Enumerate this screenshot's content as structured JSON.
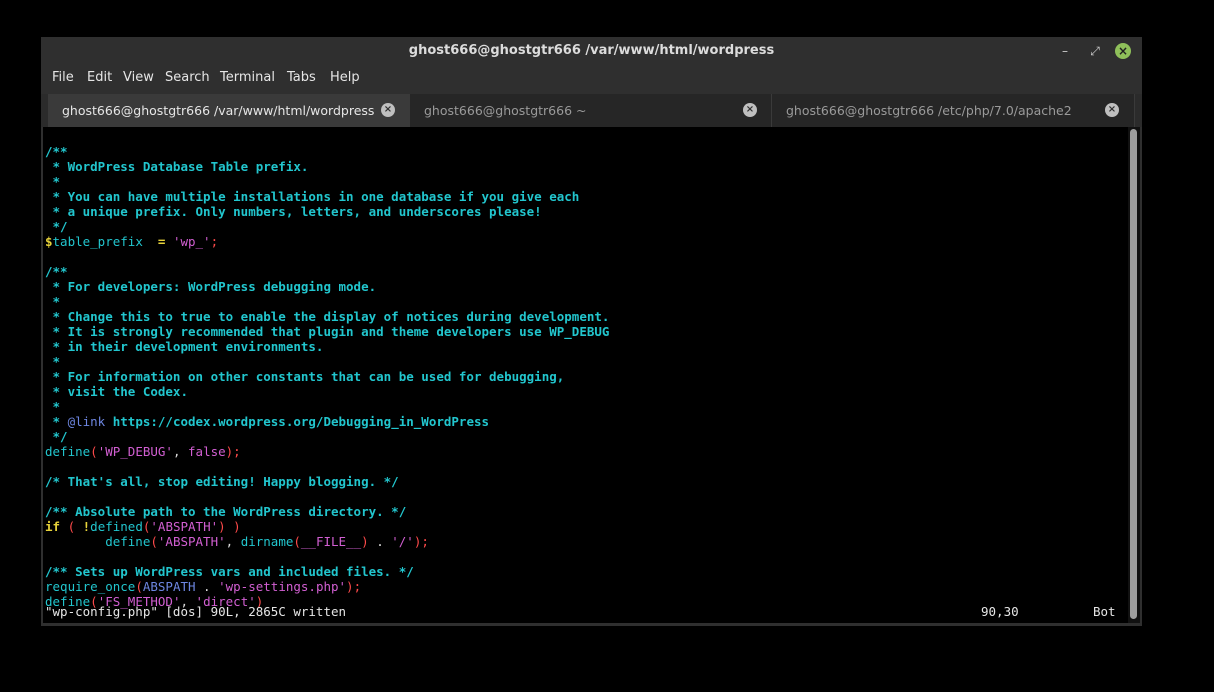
{
  "window": {
    "title": "ghost666@ghostgtr666 /var/www/html/wordpress"
  },
  "menu": [
    "File",
    "Edit",
    "View",
    "Search",
    "Terminal",
    "Tabs",
    "Help"
  ],
  "tabs": [
    {
      "label": "ghost666@ghostgtr666 /var/www/html/wordpress",
      "active": true
    },
    {
      "label": "ghost666@ghostgtr666 ~",
      "active": false
    },
    {
      "label": "ghost666@ghostgtr666 /etc/php/7.0/apache2",
      "active": false
    }
  ],
  "terminal": {
    "lines": [
      [
        {
          "t": "/**",
          "c": "com"
        }
      ],
      [
        {
          "t": " * WordPress Database Table prefix.",
          "c": "com"
        }
      ],
      [
        {
          "t": " *",
          "c": "com"
        }
      ],
      [
        {
          "t": " * You can have multiple installations in one database if you give each",
          "c": "com"
        }
      ],
      [
        {
          "t": " * a unique prefix. Only numbers, letters, and underscores please!",
          "c": "com"
        }
      ],
      [
        {
          "t": " */",
          "c": "com"
        }
      ],
      [
        {
          "t": "$",
          "c": "y"
        },
        {
          "t": "table_prefix  ",
          "c": "var"
        },
        {
          "t": "= ",
          "c": "y"
        },
        {
          "t": "'wp_'",
          "c": "str"
        },
        {
          "t": ";",
          "c": "p"
        }
      ],
      [
        {
          "t": "",
          "c": "w"
        }
      ],
      [
        {
          "t": "/**",
          "c": "com"
        }
      ],
      [
        {
          "t": " * For developers: WordPress debugging mode.",
          "c": "com"
        }
      ],
      [
        {
          "t": " *",
          "c": "com"
        }
      ],
      [
        {
          "t": " * Change this to true to enable the display of notices during development.",
          "c": "com"
        }
      ],
      [
        {
          "t": " * It is strongly recommended that plugin and theme developers use WP_DEBUG",
          "c": "com"
        }
      ],
      [
        {
          "t": " * in their development environments.",
          "c": "com"
        }
      ],
      [
        {
          "t": " *",
          "c": "com"
        }
      ],
      [
        {
          "t": " * For information on other constants that can be used for debugging,",
          "c": "com"
        }
      ],
      [
        {
          "t": " * visit the Codex.",
          "c": "com"
        }
      ],
      [
        {
          "t": " *",
          "c": "com"
        }
      ],
      [
        {
          "t": " * ",
          "c": "com"
        },
        {
          "t": "@link",
          "c": "fn"
        },
        {
          "t": " https://codex.wordpress.org/Debugging_in_WordPress",
          "c": "com"
        }
      ],
      [
        {
          "t": " */",
          "c": "com"
        }
      ],
      [
        {
          "t": "define",
          "c": "var"
        },
        {
          "t": "(",
          "c": "p"
        },
        {
          "t": "'WP_DEBUG'",
          "c": "str"
        },
        {
          "t": ", ",
          "c": "w"
        },
        {
          "t": "false",
          "c": "str"
        },
        {
          "t": ");",
          "c": "p"
        }
      ],
      [
        {
          "t": "",
          "c": "w"
        }
      ],
      [
        {
          "t": "/* That's all, stop editing! Happy blogging. */",
          "c": "com"
        }
      ],
      [
        {
          "t": "",
          "c": "w"
        }
      ],
      [
        {
          "t": "/** Absolute path to the WordPress directory. */",
          "c": "com"
        }
      ],
      [
        {
          "t": "if",
          "c": "y"
        },
        {
          "t": " ( ",
          "c": "p"
        },
        {
          "t": "!",
          "c": "y"
        },
        {
          "t": "defined",
          "c": "var"
        },
        {
          "t": "(",
          "c": "p"
        },
        {
          "t": "'ABSPATH'",
          "c": "str"
        },
        {
          "t": ") )",
          "c": "p"
        }
      ],
      [
        {
          "t": "        define",
          "c": "var"
        },
        {
          "t": "(",
          "c": "p"
        },
        {
          "t": "'ABSPATH'",
          "c": "str"
        },
        {
          "t": ", ",
          "c": "w"
        },
        {
          "t": "dirname",
          "c": "var"
        },
        {
          "t": "(",
          "c": "p"
        },
        {
          "t": "__FILE__",
          "c": "str"
        },
        {
          "t": ") ",
          "c": "p"
        },
        {
          "t": ". ",
          "c": "w"
        },
        {
          "t": "'/'",
          "c": "str"
        },
        {
          "t": ");",
          "c": "p"
        }
      ],
      [
        {
          "t": "",
          "c": "w"
        }
      ],
      [
        {
          "t": "/** Sets up WordPress vars and included files. */",
          "c": "com"
        }
      ],
      [
        {
          "t": "require_once",
          "c": "var"
        },
        {
          "t": "(",
          "c": "p"
        },
        {
          "t": "ABSPATH",
          "c": "fn"
        },
        {
          "t": " . ",
          "c": "w"
        },
        {
          "t": "'wp-settings.php'",
          "c": "str"
        },
        {
          "t": ");",
          "c": "p"
        }
      ],
      [
        {
          "t": "define",
          "c": "var"
        },
        {
          "t": "(",
          "c": "p"
        },
        {
          "t": "'FS_METHOD'",
          "c": "str"
        },
        {
          "t": ", ",
          "c": "w"
        },
        {
          "t": "'direct'",
          "c": "str"
        },
        {
          "t": ")",
          "c": "p"
        },
        {
          "t": ";",
          "c": "cursor"
        }
      ]
    ],
    "status": {
      "file": "\"wp-config.php\" [dos] 90L, 2865C written",
      "position": "90,30",
      "scroll": "Bot"
    }
  },
  "colors": {
    "comment": "#22c6ce",
    "string": "#d25fd2",
    "keyword": "#e6d23a",
    "paren": "#ff4a4a",
    "close_button": "#8fc05a"
  }
}
